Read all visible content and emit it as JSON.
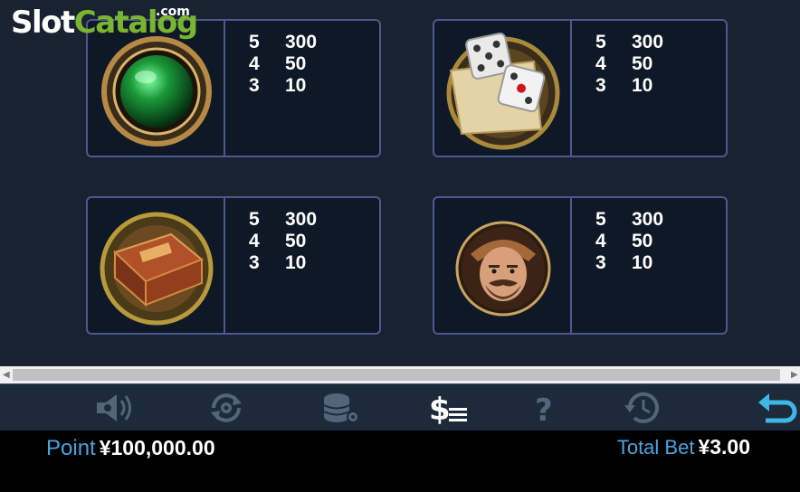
{
  "watermark": {
    "slot": "Slot",
    "catalog": "Catalog",
    "dotcom": ".com"
  },
  "paytable": [
    {
      "symbol": "green-orb-icon",
      "pays": [
        {
          "count": "5",
          "value": "300"
        },
        {
          "count": "4",
          "value": "50"
        },
        {
          "count": "3",
          "value": "10"
        }
      ]
    },
    {
      "symbol": "dice-map-icon",
      "pays": [
        {
          "count": "5",
          "value": "300"
        },
        {
          "count": "4",
          "value": "50"
        },
        {
          "count": "3",
          "value": "10"
        }
      ]
    },
    {
      "symbol": "jumanji-box-icon",
      "pays": [
        {
          "count": "5",
          "value": "300"
        },
        {
          "count": "4",
          "value": "50"
        },
        {
          "count": "3",
          "value": "10"
        }
      ]
    },
    {
      "symbol": "hunter-face-icon",
      "pays": [
        {
          "count": "5",
          "value": "300"
        },
        {
          "count": "4",
          "value": "50"
        },
        {
          "count": "3",
          "value": "10"
        }
      ]
    }
  ],
  "toolbar": {
    "icons": [
      "sound-settings-icon",
      "autoplay-settings-icon",
      "bet-settings-icon",
      "paytable-icon",
      "help-icon",
      "history-icon",
      "back-icon"
    ]
  },
  "footer": {
    "point_label": "Point",
    "point_value": "¥100,000.00",
    "total_bet_label": "Total Bet",
    "total_bet_value": "¥3.00"
  },
  "colors": {
    "accent": "#4da3e0",
    "card_border": "#4b5a8e",
    "active_icon": "#ffffff",
    "inactive_icon": "#53657a",
    "back_icon": "#3fb7e6"
  }
}
